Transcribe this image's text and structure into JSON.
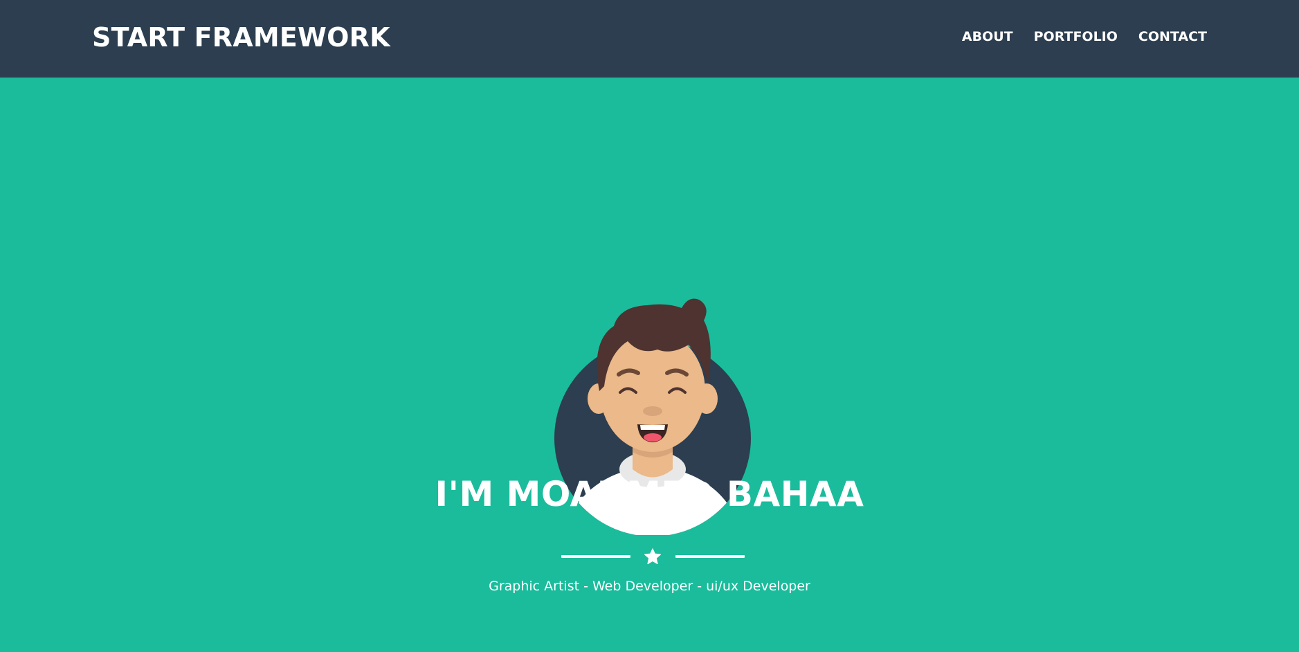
{
  "navbar": {
    "brand": "START FRAMEWORK",
    "links": [
      {
        "label": "ABOUT"
      },
      {
        "label": "PORTFOLIO"
      },
      {
        "label": "CONTACT"
      }
    ]
  },
  "hero": {
    "avatar_icon": "smiling-man-avatar-icon",
    "title": "I'M MOAHMED BAHAA",
    "divider_icon": "star-icon",
    "subtitle": "Graphic Artist - Web Developer - ui/ux Developer"
  },
  "colors": {
    "navbar_bg": "#2c3e50",
    "hero_bg": "#1abc9c",
    "text": "#ffffff",
    "avatar_circle": "#2c3e50",
    "skin": "#ebb98a",
    "hair": "#4f3330"
  }
}
